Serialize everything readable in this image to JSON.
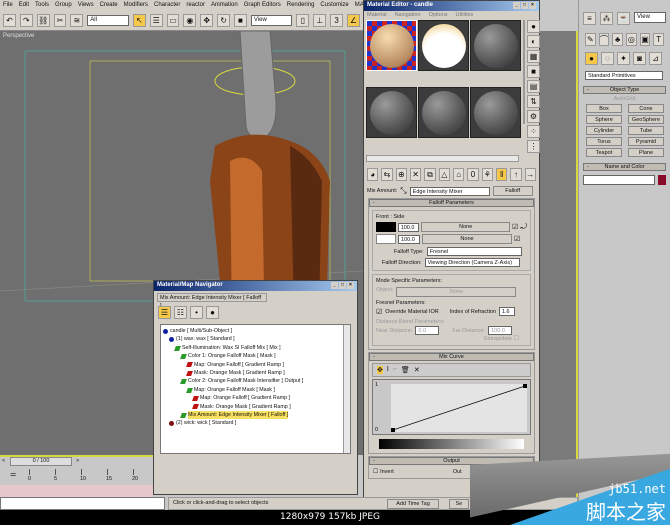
{
  "menu": [
    "File",
    "Edit",
    "Tools",
    "Group",
    "Views",
    "Create",
    "Modifiers",
    "Character",
    "reactor",
    "Animation",
    "Graph Editors",
    "Rendering",
    "Customize",
    "MAXScript"
  ],
  "toolbar": {
    "selection_filter": "All",
    "ref_coord": "View",
    "snap_badge": "3"
  },
  "viewport": {
    "label": "Perspective"
  },
  "material_editor": {
    "title": "Material Editor - candle",
    "menu": [
      "Material",
      "Navigation",
      "Options",
      "Utilities"
    ],
    "mix_amount_label": "Mix Amount:",
    "map_name": "Edge Intensity Mixer",
    "map_type": "Falloff",
    "falloff_rollout": "Falloff Parameters",
    "front_side": "Front : Side",
    "front_value": "100.0",
    "side_value": "100.0",
    "none": "None",
    "falloff_type_label": "Falloff Type:",
    "falloff_type": "Fresnel",
    "falloff_direction_label": "Falloff Direction:",
    "falloff_direction": "Viewing Direction (Camera Z-Axis)",
    "mode_specific": "Mode Specific Parameters:",
    "object_label": "Object:",
    "fresnel_params": "Fresnel Parameters:",
    "override_ior": "Override Material IOR",
    "ior_label": "Index of Refraction",
    "ior_value": "1.6",
    "distance_blend": "Distance Blend Parameters:",
    "near_label": "Near Distance:",
    "near_value": "0.0",
    "far_label": "Far Distance:",
    "far_value": "100.0",
    "extrapolate": "Extrapolate",
    "mix_curve": "Mix Curve",
    "curve_y_max": "1",
    "curve_y_min": "0",
    "output": "Output",
    "invert": "Invert",
    "output_amount_label": "Out"
  },
  "navigator": {
    "title": "Material/Map Navigator",
    "path": "Mix Amount: Edge Intensity Mixer  [ Falloff ]",
    "tree": [
      {
        "text": "candle  [ Multi/Sub-Object ]",
        "color": "#1020a0",
        "depth": 0
      },
      {
        "text": "(1) wax: wax  [ Standard ]",
        "color": "#1020a0",
        "depth": 1
      },
      {
        "text": "Self-Illumination: Wax SI Falloff Mix  [ Mix ]",
        "color": "#2a9a2a",
        "depth": 2
      },
      {
        "text": "Color 1: Orange Falloff Mask  [ Mask ]",
        "color": "#2a9a2a",
        "depth": 3
      },
      {
        "text": "Map: Orange Falloff  [ Gradient Ramp ]",
        "color": "#c01010",
        "depth": 4
      },
      {
        "text": "Mask: Orange Mask  [ Gradient Ramp ]",
        "color": "#c01010",
        "depth": 4
      },
      {
        "text": "Color 2: Orange Falloff Mask Intensifier  [ Output ]",
        "color": "#2a9a2a",
        "depth": 3
      },
      {
        "text": "Map: Orange Falloff Mask  [ Mask ]",
        "color": "#2a9a2a",
        "depth": 4
      },
      {
        "text": "Map: Orange Falloff  [ Gradient Ramp ]",
        "color": "#c01010",
        "depth": 5
      },
      {
        "text": "Mask: Orange Mask  [ Gradient Ramp ]",
        "color": "#c01010",
        "depth": 5
      },
      {
        "text": "Mix Amount: Edge Intensity Mixer  [ Falloff ]",
        "color": "#2a9a2a",
        "depth": 3,
        "selected": true
      },
      {
        "text": "(2) wick: wick  [ Standard ]",
        "color": "#801010",
        "depth": 1
      }
    ]
  },
  "command_panel": {
    "dropdown": "Standard Primitives",
    "object_type": "Object Type",
    "autogrid": "AutoGrid",
    "buttons": [
      "Box",
      "Cone",
      "Sphere",
      "GeoSphere",
      "Cylinder",
      "Tube",
      "Torus",
      "Pyramid",
      "Teapot",
      "Plane"
    ],
    "name_and_color": "Name and Color",
    "object_color": "#8a0a2a",
    "view": "View"
  },
  "timeline": {
    "frame": "0 / 100",
    "ticks": [
      "0",
      "5",
      "10",
      "15",
      "20"
    ]
  },
  "status": {
    "prompt": "Click or click-and-drag to select objects",
    "add_time_tag": "Add Time Tag",
    "set_key": "Se"
  },
  "caption": "1280x979  157kb  JPEG",
  "watermark": {
    "url": "jb51.net",
    "name": "脚本之家"
  }
}
